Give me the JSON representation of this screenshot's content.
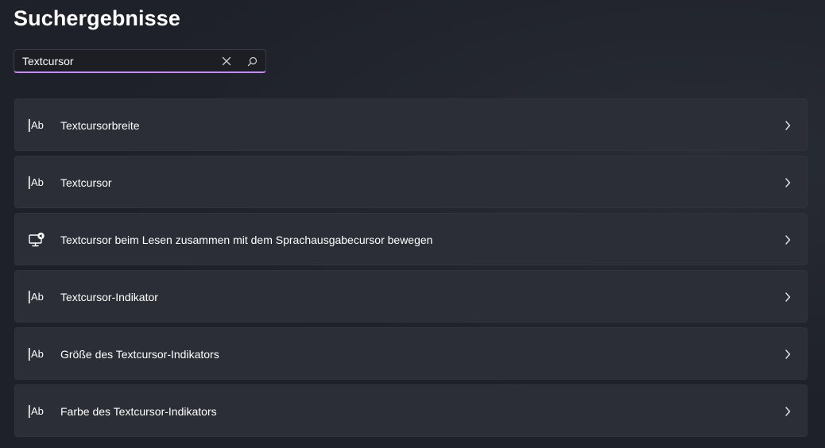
{
  "page": {
    "title": "Suchergebnisse"
  },
  "search": {
    "value": "Textcursor",
    "accent_color": "#c58af9",
    "clear_icon": "close-icon",
    "search_icon": "search-icon"
  },
  "results": [
    {
      "label": "Textcursorbreite",
      "icon": "text-cursor-icon"
    },
    {
      "label": "Textcursor",
      "icon": "text-cursor-icon"
    },
    {
      "label": "Textcursor beim Lesen zusammen mit dem Sprachausgabecursor bewegen",
      "icon": "narrator-monitor-icon"
    },
    {
      "label": "Textcursor-Indikator",
      "icon": "text-cursor-icon"
    },
    {
      "label": "Größe des Textcursor-Indikators",
      "icon": "text-cursor-icon"
    },
    {
      "label": "Farbe des Textcursor-Indikators",
      "icon": "text-cursor-icon"
    }
  ]
}
